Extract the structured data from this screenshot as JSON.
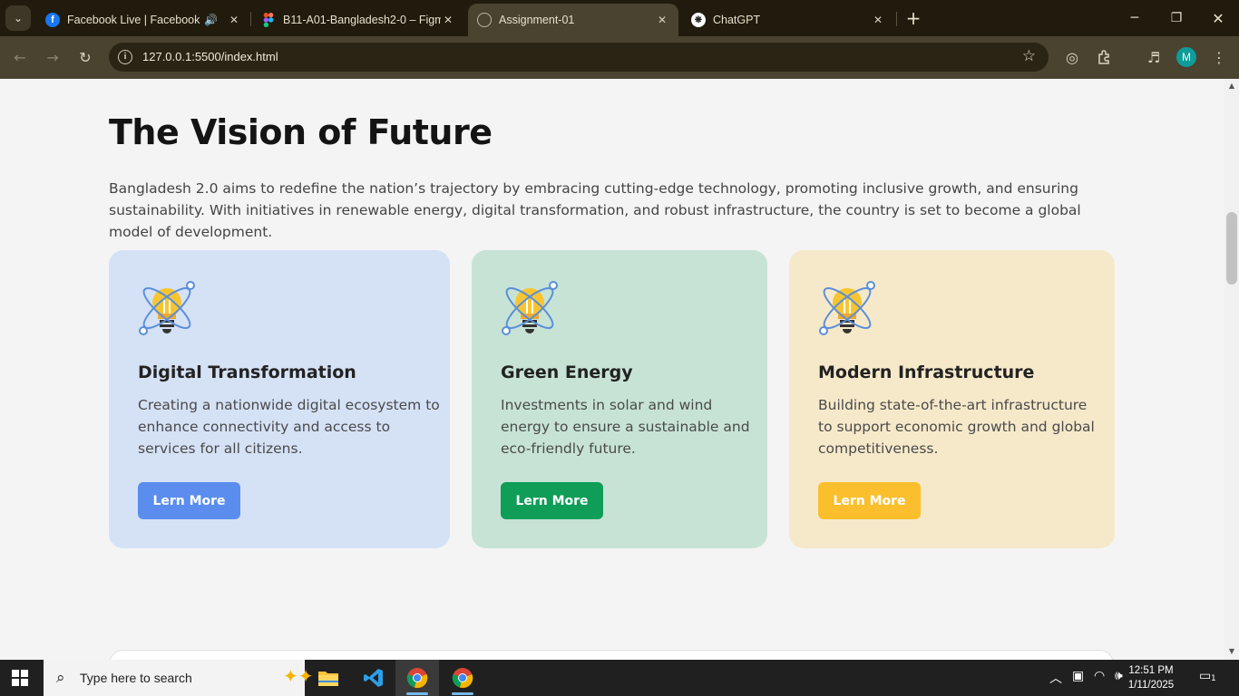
{
  "browser": {
    "tabs": [
      {
        "title": "Facebook Live | Facebook",
        "favicon": "facebook-icon",
        "audio": true,
        "active": false
      },
      {
        "title": "B11-A01-Bangladesh2-0 – Figma",
        "favicon": "figma-icon",
        "audio": false,
        "active": false
      },
      {
        "title": "Assignment-01",
        "favicon": "globe-icon",
        "audio": false,
        "active": true
      },
      {
        "title": "ChatGPT",
        "favicon": "chatgpt-icon",
        "audio": false,
        "active": false
      }
    ],
    "url": "127.0.0.1:5500/index.html",
    "profile_initial": "M"
  },
  "page": {
    "title": "The Vision of Future",
    "intro": "Bangladesh 2.0 aims to redefine the nation’s trajectory by embracing cutting-edge technology, promoting inclusive growth, and ensuring sustainability. With initiatives in renewable energy, digital transformation, and robust infrastructure, the country is set to become a global model of development.",
    "cards": [
      {
        "heading": "Digital Transformation",
        "lines": [
          "Creating a nationwide digital ecosystem to",
          "enhance connectivity and access to",
          "services for all citizens."
        ],
        "button": "Lern More",
        "bg": "#d5e1f5",
        "button_color": "#5b8def"
      },
      {
        "heading": "Green Energy",
        "lines": [
          "Investments in solar and wind",
          "energy to ensure a sustainable and",
          "eco-friendly future."
        ],
        "button": "Lern More",
        "bg": "#c7e3d5",
        "button_color": "#0f9d58"
      },
      {
        "heading": "Modern Infrastructure",
        "lines": [
          "Building state-of-the-art infrastructure",
          "to support economic growth and global",
          "competitiveness."
        ],
        "button": "Lern More",
        "bg": "#f6e9ca",
        "button_color": "#fbbf2e"
      }
    ]
  },
  "taskbar": {
    "search_placeholder": "Type here to search",
    "time": "12:51 PM",
    "date": "1/11/2025",
    "notification_count": "1"
  }
}
